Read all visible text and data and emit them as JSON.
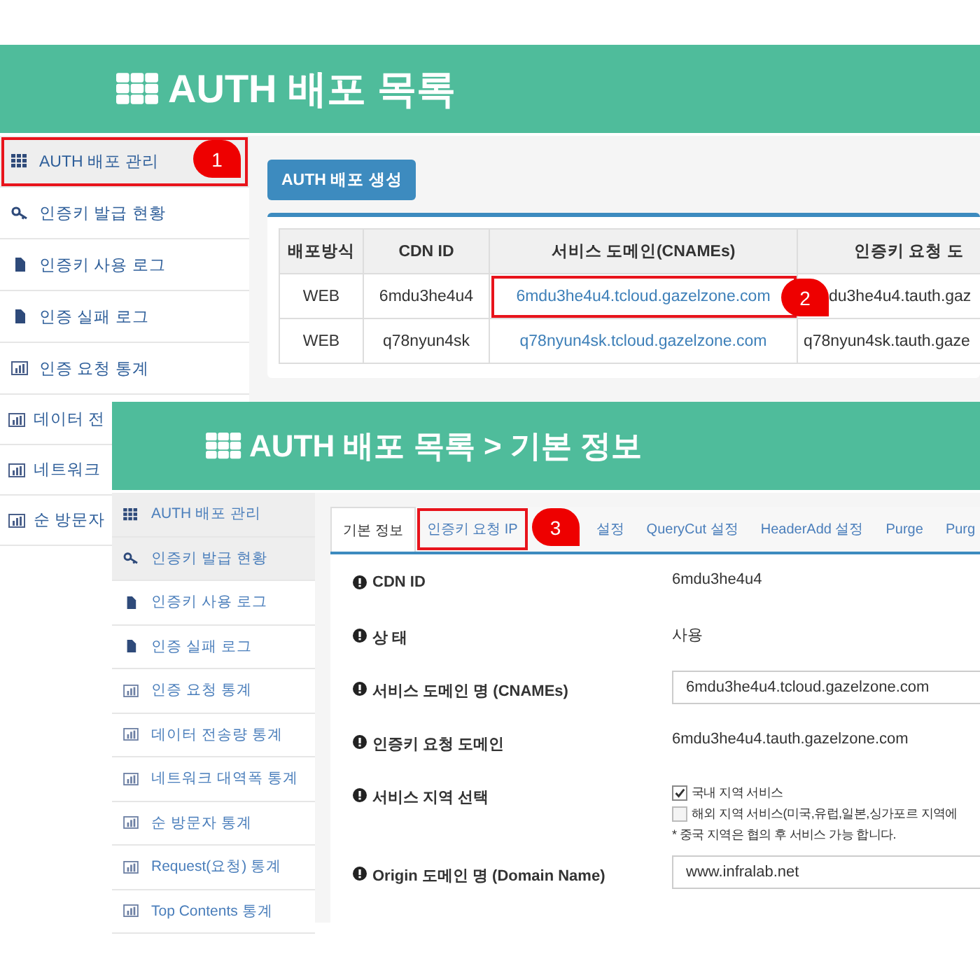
{
  "top_panel": {
    "title": "AUTH 배포 목록",
    "sidebar": [
      {
        "label": "AUTH 배포 관리",
        "kind": "grid",
        "selected": true,
        "callout": "1"
      },
      {
        "label": "인증키 발급 현황",
        "kind": "key",
        "selected": false
      },
      {
        "label": "인증키 사용 로그",
        "kind": "document",
        "selected": false
      },
      {
        "label": "인증 실패 로그",
        "kind": "document",
        "selected": false
      },
      {
        "label": "인증 요청 통계",
        "kind": "chart",
        "selected": false
      },
      {
        "label": "데이터 전",
        "kind": "chart",
        "selected": false
      },
      {
        "label": "네트워크",
        "kind": "chart",
        "selected": false
      },
      {
        "label": "순 방문자",
        "kind": "chart",
        "selected": false
      }
    ],
    "create_button": "AUTH 배포 생성",
    "table": {
      "columns": [
        "배포방식",
        "CDN ID",
        "서비스 도메인(CNAMEs)",
        "인증키 요청 도"
      ],
      "rows": [
        {
          "cells": [
            "WEB",
            "6mdu3he4u4",
            "6mdu3he4u4.tcloud.gazelzone.com",
            "du3he4u4.tauth.gaz"
          ],
          "callout": "2"
        },
        {
          "cells": [
            "WEB",
            "q78nyun4sk",
            "q78nyun4sk.tcloud.gazelzone.com",
            "q78nyun4sk.tauth.gaze"
          ]
        }
      ]
    }
  },
  "bottom_panel": {
    "title": "AUTH 배포 목록 > 기본 정보",
    "sidebar": [
      {
        "label": "AUTH 배포 관리",
        "kind": "grid",
        "selected": true
      },
      {
        "label": "인증키 발급 현황",
        "kind": "key",
        "selected": true
      },
      {
        "label": "인증키 사용 로그",
        "kind": "document",
        "selected": false
      },
      {
        "label": "인증 실패 로그",
        "kind": "document",
        "selected": false
      },
      {
        "label": "인증 요청 통계",
        "kind": "chart",
        "selected": false
      },
      {
        "label": "데이터 전송량 통계",
        "kind": "chart",
        "selected": false
      },
      {
        "label": "네트워크 대역폭 통계",
        "kind": "chart",
        "selected": false
      },
      {
        "label": "순 방문자 통계",
        "kind": "chart",
        "selected": false
      },
      {
        "label": "Request(요청) 통계",
        "kind": "chart",
        "selected": false
      },
      {
        "label": "Top Contents 통계",
        "kind": "chart",
        "selected": false
      }
    ],
    "tabs": [
      {
        "label": "기본 정보",
        "selected": true
      },
      {
        "label": "인증키 요청 IP",
        "selected": false,
        "callout": "3"
      },
      {
        "label": "설정",
        "selected": false
      },
      {
        "label": "QueryCut 설정",
        "selected": false
      },
      {
        "label": "HeaderAdd 설정",
        "selected": false
      },
      {
        "label": "Purge",
        "selected": false
      },
      {
        "label": "Purg",
        "selected": false
      }
    ],
    "fields": [
      {
        "label": "CDN ID",
        "kind": "text",
        "value": "6mdu3he4u4"
      },
      {
        "label": "상 태",
        "kind": "text",
        "value": "사용"
      },
      {
        "label": "서비스 도메인 명 (CNAMEs)",
        "kind": "input",
        "value": "6mdu3he4u4.tcloud.gazelzone.com"
      },
      {
        "label": "인증키 요청 도메인",
        "kind": "text",
        "value": "6mdu3he4u4.tauth.gazelzone.com"
      },
      {
        "label": "서비스 지역 선택",
        "kind": "checks",
        "options": [
          {
            "label": "국내 지역 서비스",
            "checked": true
          },
          {
            "label": "해외 지역 서비스(미국,유럽,일본,싱가포르 지역에",
            "checked": false
          }
        ],
        "note": "* 중국 지역은 협의 후 서비스 가능 합니다."
      },
      {
        "label": "Origin 도메인 명 (Domain Name)",
        "kind": "input",
        "value": "www.infralab.net"
      }
    ]
  }
}
